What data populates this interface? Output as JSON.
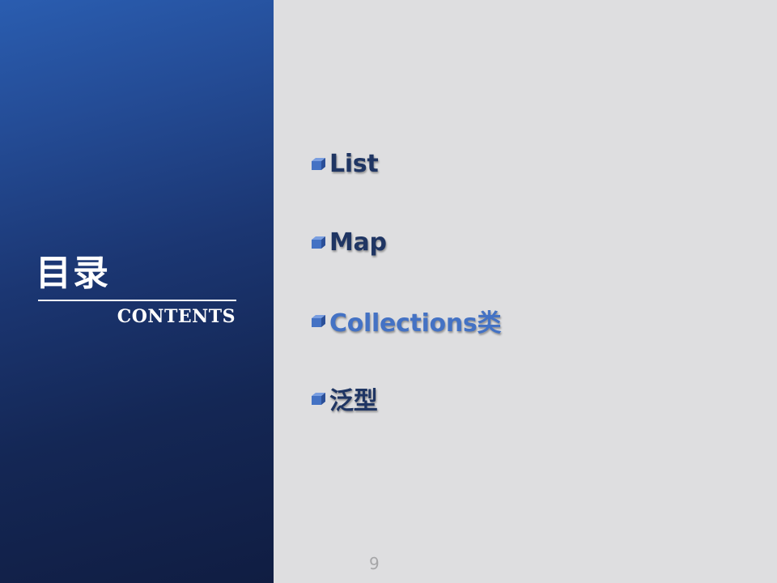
{
  "sidebar": {
    "title": "目录",
    "subtitle": "CONTENTS"
  },
  "menu": {
    "items": [
      {
        "label": "List",
        "color": "#1f3563"
      },
      {
        "label": "Map",
        "color": "#1f3563"
      },
      {
        "label": "Collections类",
        "color": "#4472c4"
      },
      {
        "label": "泛型",
        "color": "#1f3563"
      }
    ],
    "bullet_icon": "blue-cube-icon",
    "bullet_color": "#4472c4"
  },
  "footer": {
    "page_number": "9"
  }
}
